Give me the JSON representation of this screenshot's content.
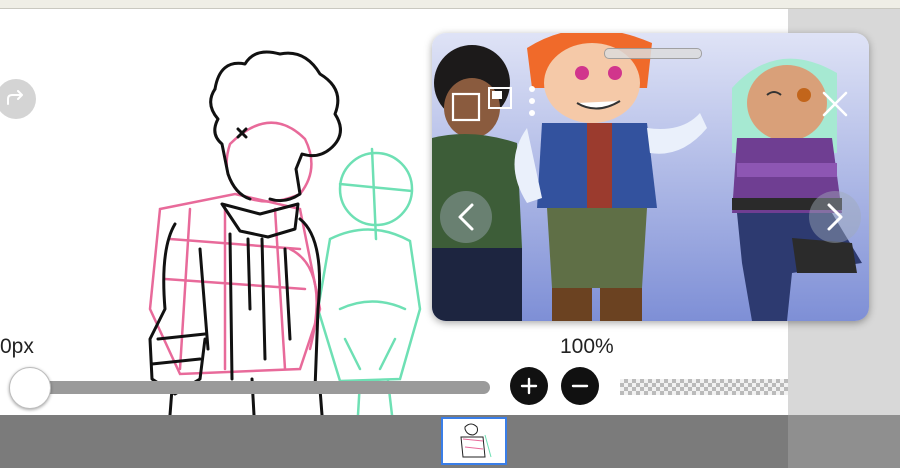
{
  "canvas": {
    "brush_size_label": "0px",
    "opacity_label": "100%",
    "brush_size_slider": {
      "value_fraction": 0.0
    }
  },
  "toolbar": {
    "redo_icon": "redo-icon",
    "zoom_in_icon": "plus-icon",
    "zoom_out_icon": "minus-icon"
  },
  "reference_window": {
    "icons": [
      "drag-handle",
      "window-mode-icon",
      "picture-in-picture-icon",
      "more-options-icon",
      "close-icon",
      "chevron-left-icon",
      "chevron-right-icon"
    ]
  },
  "layers": {
    "thumbnails": [
      {
        "selected": true
      }
    ]
  },
  "colors": {
    "accent": "#3a7ee8",
    "sketch_black": "#111111",
    "sketch_pink": "#e86a9a",
    "sketch_mint": "#6ee0b4"
  }
}
